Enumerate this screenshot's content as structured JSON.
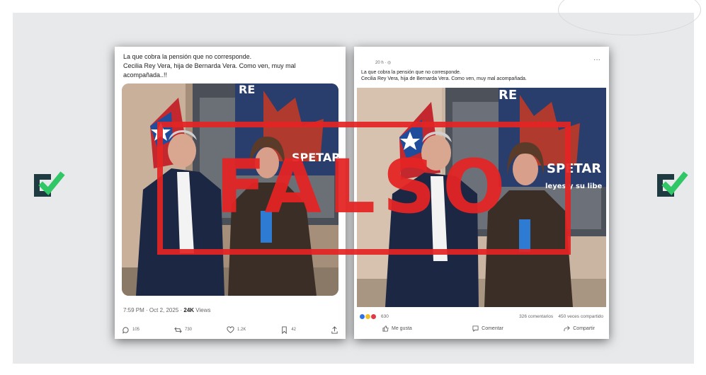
{
  "x_post": {
    "text_line1": "La que cobra la pensión que no corresponde.",
    "text_line2": "Cecilia Rey Vera, hija de Bernarda Vera. Como ven, muy mal",
    "text_line3": "acompañada..!!",
    "time": "7:59 PM · Oct 2, 2025 · ",
    "views": "24K",
    "views_label": " Views",
    "replies": "105",
    "reposts": "730",
    "likes": "1.2K",
    "bookmarks": "42",
    "banner_fragment_1": "RE",
    "banner_fragment_2": "SPETAR"
  },
  "fb_post": {
    "time": "20 h · ",
    "text_line1": "La que cobra la pensión que no corresponde.",
    "text_line2": "Cecilia Rey Vera, hija de Bernarda Vera. Como ven, muy mal acompañada.",
    "reactions": "630",
    "comments": "326 comentarios",
    "shares": "450 veces compartido",
    "like_label": "Me gusta",
    "comment_label": "Comentar",
    "share_label": "Compartir",
    "more": "···",
    "banner_fragment_1": "RE",
    "banner_fragment_2": "SPETAR",
    "banner_fragment_3": "leyes y su libe"
  },
  "stamp": {
    "label": "FALSO",
    "color": "#e42424"
  },
  "logo": {
    "icon": "check-logo-icon",
    "dark": "#1f3a40",
    "accent": "#32c766"
  }
}
